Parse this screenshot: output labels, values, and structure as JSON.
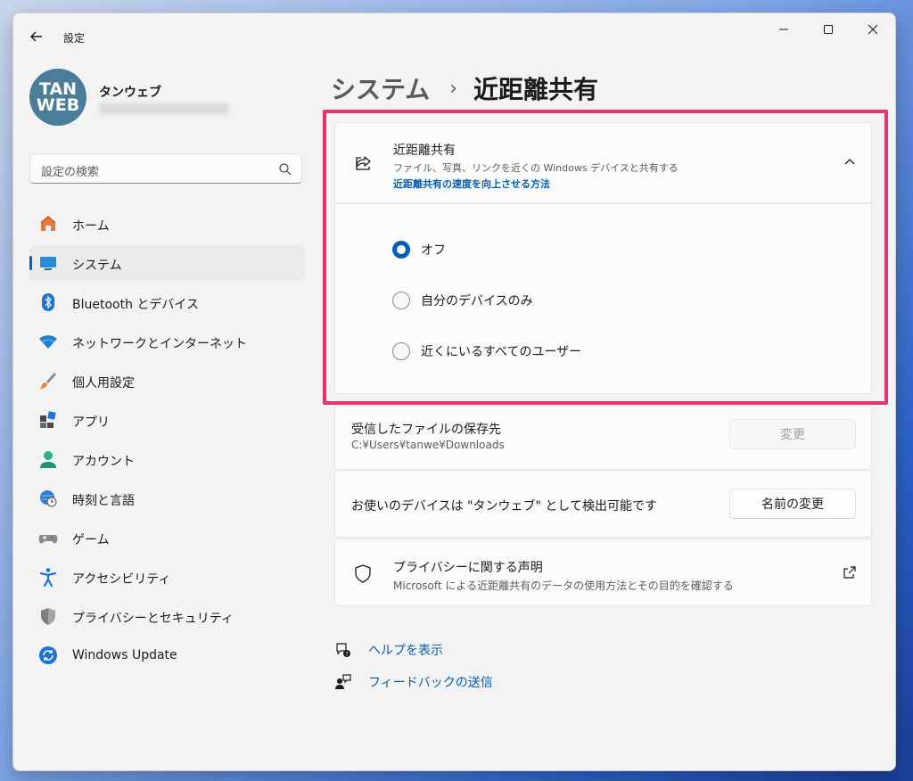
{
  "window": {
    "title": "設定"
  },
  "profile": {
    "name": "タンウェブ",
    "avatar_lines": [
      "TAN",
      "WEB"
    ]
  },
  "search": {
    "placeholder": "設定の検索"
  },
  "nav": {
    "items": [
      {
        "label": "ホーム",
        "icon": "home-icon"
      },
      {
        "label": "システム",
        "icon": "system-icon",
        "active": true
      },
      {
        "label": "Bluetooth とデバイス",
        "icon": "bluetooth-icon"
      },
      {
        "label": "ネットワークとインターネット",
        "icon": "wifi-icon"
      },
      {
        "label": "個人用設定",
        "icon": "brush-icon"
      },
      {
        "label": "アプリ",
        "icon": "apps-icon"
      },
      {
        "label": "アカウント",
        "icon": "account-icon"
      },
      {
        "label": "時刻と言語",
        "icon": "clock-globe-icon"
      },
      {
        "label": "ゲーム",
        "icon": "gamepad-icon"
      },
      {
        "label": "アクセシビリティ",
        "icon": "accessibility-icon"
      },
      {
        "label": "プライバシーとセキュリティ",
        "icon": "shield-icon"
      },
      {
        "label": "Windows Update",
        "icon": "update-icon"
      }
    ]
  },
  "breadcrumb": {
    "parent": "システム",
    "separator": "›",
    "current": "近距離共有"
  },
  "nearby_share": {
    "title": "近距離共有",
    "description": "ファイル、写真、リンクを近くの Windows デバイスと共有する",
    "link": "近距離共有の速度を向上させる方法",
    "options": [
      {
        "label": "オフ",
        "checked": true
      },
      {
        "label": "自分のデバイスのみ",
        "checked": false
      },
      {
        "label": "近くにいるすべてのユーザー",
        "checked": false
      }
    ]
  },
  "save_location": {
    "title": "受信したファイルの保存先",
    "path": "C:¥Users¥tanwe¥Downloads",
    "button": "変更"
  },
  "discoverable": {
    "text": "お使いのデバイスは \"タンウェブ\" として検出可能です",
    "button": "名前の変更"
  },
  "privacy": {
    "title": "プライバシーに関する声明",
    "description": "Microsoft による近距離共有のデータの使用方法とその目的を確認する"
  },
  "footer": {
    "help": "ヘルプを表示",
    "feedback": "フィードバックの送信"
  },
  "colors": {
    "accent": "#005fb8",
    "highlight": "#e8336f"
  }
}
